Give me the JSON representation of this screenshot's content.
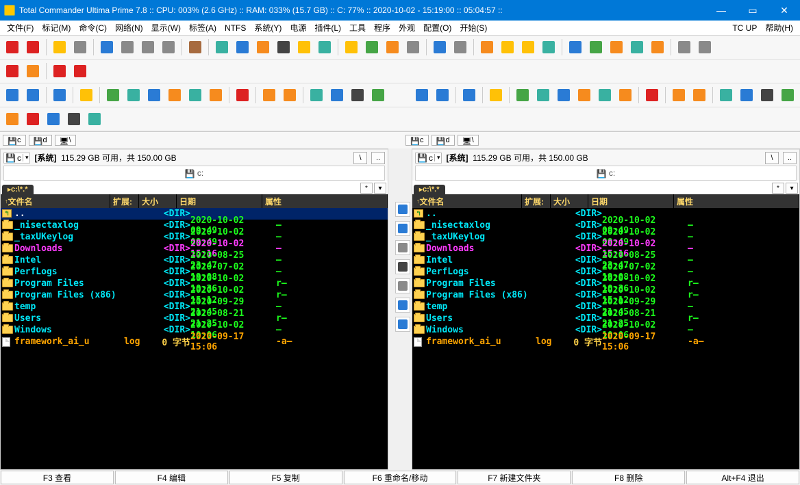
{
  "title": "Total Commander Ultima Prime 7.8 :: CPU: 003% (2.6 GHz) :: RAM: 033% (15.7 GB) :: C: 77% :: 2020-10-02 - 15:19:00 :: 05:04:57 ::",
  "menus": [
    "文件(F)",
    "标记(M)",
    "命令(C)",
    "网络(N)",
    "显示(W)",
    "标签(A)",
    "NTFS",
    "系统(Y)",
    "电源",
    "插件(L)",
    "工具",
    "程序",
    "外观",
    "配置(O)",
    "开始(S)"
  ],
  "menuRight": [
    "TC UP",
    "帮助(H)"
  ],
  "driveInfo": {
    "label": "[系统]",
    "free": "115.29 GB 可用，共  150.00 GB"
  },
  "pathIndicator": "c:",
  "dirTab": "c:\\*.*",
  "headers": {
    "name": "文件名",
    "nameArrow": "↑",
    "ext": "扩展:",
    "size": "大小",
    "date": "日期",
    "attr": "属性"
  },
  "rows": [
    {
      "type": "up",
      "name": "..",
      "ext": "",
      "size": "<DIR>",
      "date": "",
      "attr": ""
    },
    {
      "type": "dir",
      "name": "_nisectaxlog",
      "ext": "",
      "size": "<DIR>",
      "date": "2020-10-02 09:49",
      "attr": "—"
    },
    {
      "type": "dir",
      "name": "_taxUKeylog",
      "ext": "",
      "size": "<DIR>",
      "date": "2020-10-02 09:49",
      "attr": "—"
    },
    {
      "type": "pink",
      "name": "Downloads",
      "ext": "",
      "size": "<DIR>",
      "date": "2020-10-02 15:16",
      "attr": "—"
    },
    {
      "type": "dir",
      "name": "Intel",
      "ext": "",
      "size": "<DIR>",
      "date": "2020-08-25 23:47",
      "attr": "—"
    },
    {
      "type": "dir",
      "name": "PerfLogs",
      "ext": "",
      "size": "<DIR>",
      "date": "2020-07-02 19:08",
      "attr": "—"
    },
    {
      "type": "dir",
      "name": "Program Files",
      "ext": "",
      "size": "<DIR>",
      "date": "2020-10-02 10:36",
      "attr": "r—"
    },
    {
      "type": "dir",
      "name": "Program Files (x86)",
      "ext": "",
      "size": "<DIR>",
      "date": "2020-10-02 15:12",
      "attr": "r—"
    },
    {
      "type": "dir",
      "name": "temp",
      "ext": "",
      "size": "<DIR>",
      "date": "2020-09-29 21:45",
      "attr": "—"
    },
    {
      "type": "dir",
      "name": "Users",
      "ext": "",
      "size": "<DIR>",
      "date": "2020-08-21 21:25",
      "attr": "r—"
    },
    {
      "type": "dir",
      "name": "Windows",
      "ext": "",
      "size": "<DIR>",
      "date": "2020-10-02 10:06",
      "attr": "—"
    },
    {
      "type": "file",
      "name": "framework_ai_u",
      "ext": "log",
      "size": "0 字节",
      "date": "2020-09-17 15:06",
      "attr": "-a—"
    }
  ],
  "fbar": [
    "F3 查看",
    "F4 编辑",
    "F5 复制",
    "F6 重命名/移动",
    "F7 新建文件夹",
    "F8 删除",
    "Alt+F4 退出"
  ],
  "toolbar1Names": [
    "views-1",
    "views-2",
    "warning",
    "tool-a",
    "list-large",
    "list-small",
    "details",
    "thumbs",
    "case",
    "screen",
    "app1",
    "cube",
    "dark",
    "folder",
    "settings",
    "new-file",
    "edit-file",
    "paste",
    "tree",
    "search",
    "calc",
    "clipboard",
    "note",
    "note2",
    "cards",
    "net1",
    "net2",
    "net3",
    "net4",
    "net5",
    "chain1",
    "chain2"
  ],
  "toolbar2Names": [
    "stop",
    "refresh",
    "rec",
    "power"
  ],
  "toolbar3Names": [
    "back",
    "forward",
    "up",
    "home",
    "edit",
    "swap",
    "play",
    "loop",
    "fast",
    "fav",
    "close",
    "stack",
    "crop",
    "window",
    "music",
    "film",
    "diff"
  ],
  "toolbar4Names": [
    "crop2",
    "cal",
    "note3",
    "film2",
    "pic"
  ],
  "sidetoolNames": [
    "swap-panels",
    "app-blue",
    "property",
    "hex",
    "pad",
    "disk-save",
    "save-as"
  ]
}
